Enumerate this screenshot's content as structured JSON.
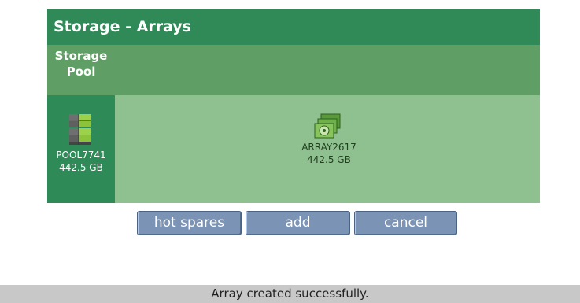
{
  "panel": {
    "title": "Storage - Arrays",
    "pool_header_line1": "Storage",
    "pool_header_line2": "Pool"
  },
  "pool": {
    "name": "POOL7741",
    "size": "442.5 GB",
    "icon": "storage-pool-icon"
  },
  "arrays": [
    {
      "name": "ARRAY2617",
      "size": "442.5 GB",
      "icon": "disk-array-icon"
    }
  ],
  "buttons": {
    "hot_spares": "hot spares",
    "add": "add",
    "cancel": "cancel"
  },
  "status": {
    "message": "Array created successfully."
  },
  "colors": {
    "title_bar": "#2f8a58",
    "header_band": "#5f9f65",
    "array_area": "#8fc08f",
    "button": "#7b93b4",
    "status_bar": "#c8c8c8"
  }
}
